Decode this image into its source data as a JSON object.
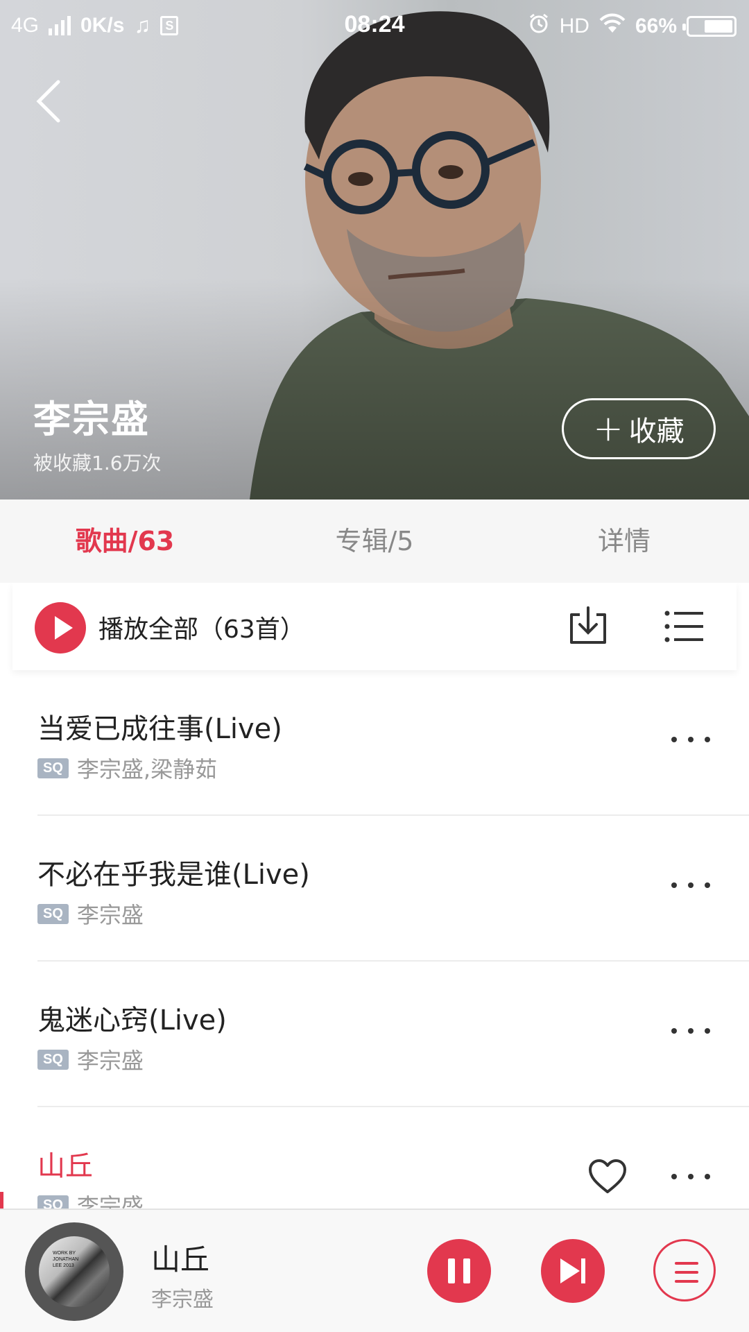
{
  "status_bar": {
    "network": "4G",
    "speed": "0K/s",
    "time": "08:24",
    "hd": "HD",
    "battery": "66%",
    "battery_level": 0.66
  },
  "artist": {
    "name": "李宗盛",
    "favorites": "被收藏1.6万次",
    "collect_label": "收藏"
  },
  "tabs": [
    {
      "label": "歌曲/63"
    },
    {
      "label": "专辑/5"
    },
    {
      "label": "详情"
    }
  ],
  "play_all": {
    "label": "播放全部（63首）"
  },
  "songs": [
    {
      "title": "当爱已成往事(Live)",
      "quality": "SQ",
      "artist": "李宗盛,梁静茹"
    },
    {
      "title": "不必在乎我是谁(Live)",
      "quality": "SQ",
      "artist": "李宗盛"
    },
    {
      "title": "鬼迷心窍(Live)",
      "quality": "SQ",
      "artist": "李宗盛"
    },
    {
      "title": "山丘",
      "quality": "SQ",
      "artist": "李宗盛"
    }
  ],
  "now_playing": {
    "title": "山丘",
    "artist": "李宗盛",
    "album_text": "WORK BY JONATHAN LEE 2013"
  },
  "colors": {
    "accent": "#e2384e",
    "tab_inactive": "#888888",
    "sq_badge": "#a9b4c2"
  }
}
